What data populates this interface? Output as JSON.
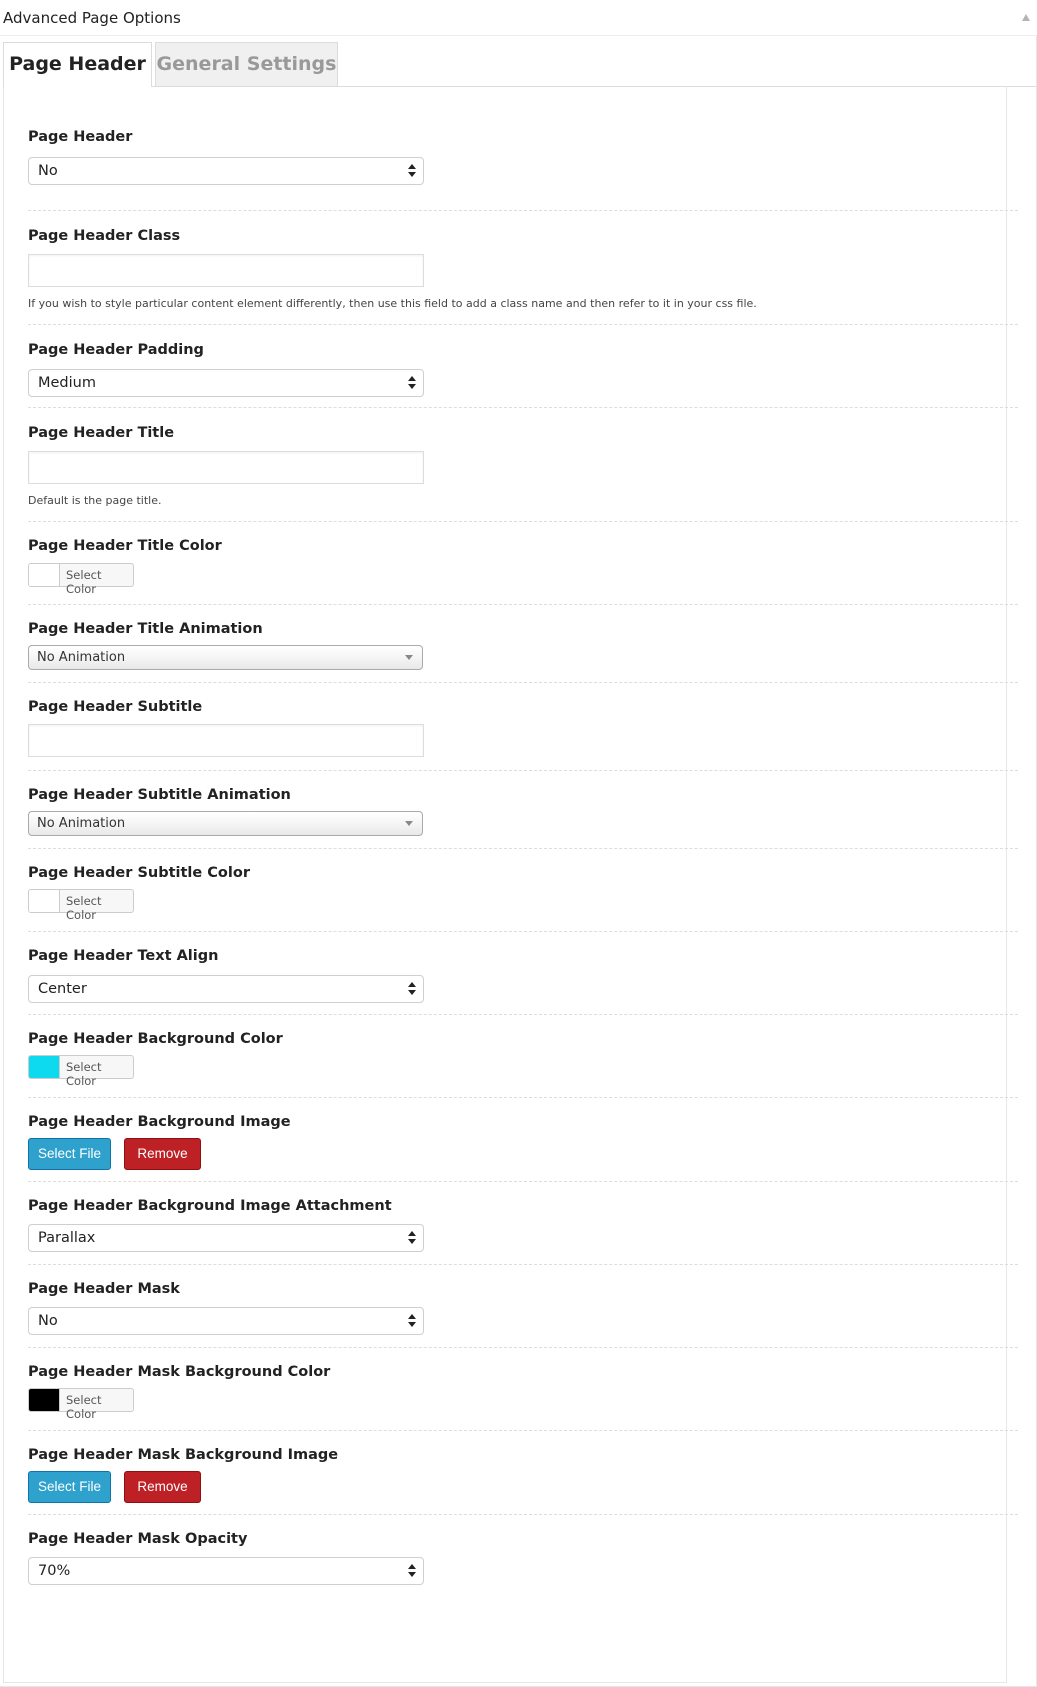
{
  "panel": {
    "title": "Advanced Page Options"
  },
  "tabs": [
    {
      "label": "Page Header",
      "active": true
    },
    {
      "label": "General Settings",
      "active": false
    }
  ],
  "colors": {
    "accent_blue": "#2ea2cc",
    "remove_red": "#bd2025",
    "bg_color_swatch": "#0dd9ef",
    "mask_color_swatch": "#000000",
    "empty_swatch": "#ffffff"
  },
  "fields": {
    "page_header": {
      "label": "Page Header",
      "value": "No"
    },
    "page_header_class": {
      "label": "Page Header Class",
      "value": "",
      "hint": "If you wish to style particular content element differently, then use this field to add a class name and then refer to it in your css file."
    },
    "page_header_padding": {
      "label": "Page Header Padding",
      "value": "Medium"
    },
    "page_header_title": {
      "label": "Page Header Title",
      "value": "",
      "hint": "Default is the page title."
    },
    "page_header_title_color": {
      "label": "Page Header Title Color",
      "button": "Select Color"
    },
    "page_header_title_animation": {
      "label": "Page Header Title Animation",
      "value": "No Animation"
    },
    "page_header_subtitle": {
      "label": "Page Header Subtitle",
      "value": ""
    },
    "page_header_subtitle_animation": {
      "label": "Page Header Subtitle Animation",
      "value": "No Animation"
    },
    "page_header_subtitle_color": {
      "label": "Page Header Subtitle Color",
      "button": "Select Color"
    },
    "page_header_text_align": {
      "label": "Page Header Text Align",
      "value": "Center"
    },
    "page_header_bg_color": {
      "label": "Page Header Background Color",
      "button": "Select Color"
    },
    "page_header_bg_image": {
      "label": "Page Header Background Image",
      "select_label": "Select File",
      "remove_label": "Remove"
    },
    "page_header_bg_attachment": {
      "label": "Page Header Background Image Attachment",
      "value": "Parallax"
    },
    "page_header_mask": {
      "label": "Page Header Mask",
      "value": "No"
    },
    "page_header_mask_bg_color": {
      "label": "Page Header Mask Background Color",
      "button": "Select Color"
    },
    "page_header_mask_bg_image": {
      "label": "Page Header Mask Background Image",
      "select_label": "Select File",
      "remove_label": "Remove"
    },
    "page_header_mask_opacity": {
      "label": "Page Header Mask Opacity",
      "value": "70%"
    }
  }
}
